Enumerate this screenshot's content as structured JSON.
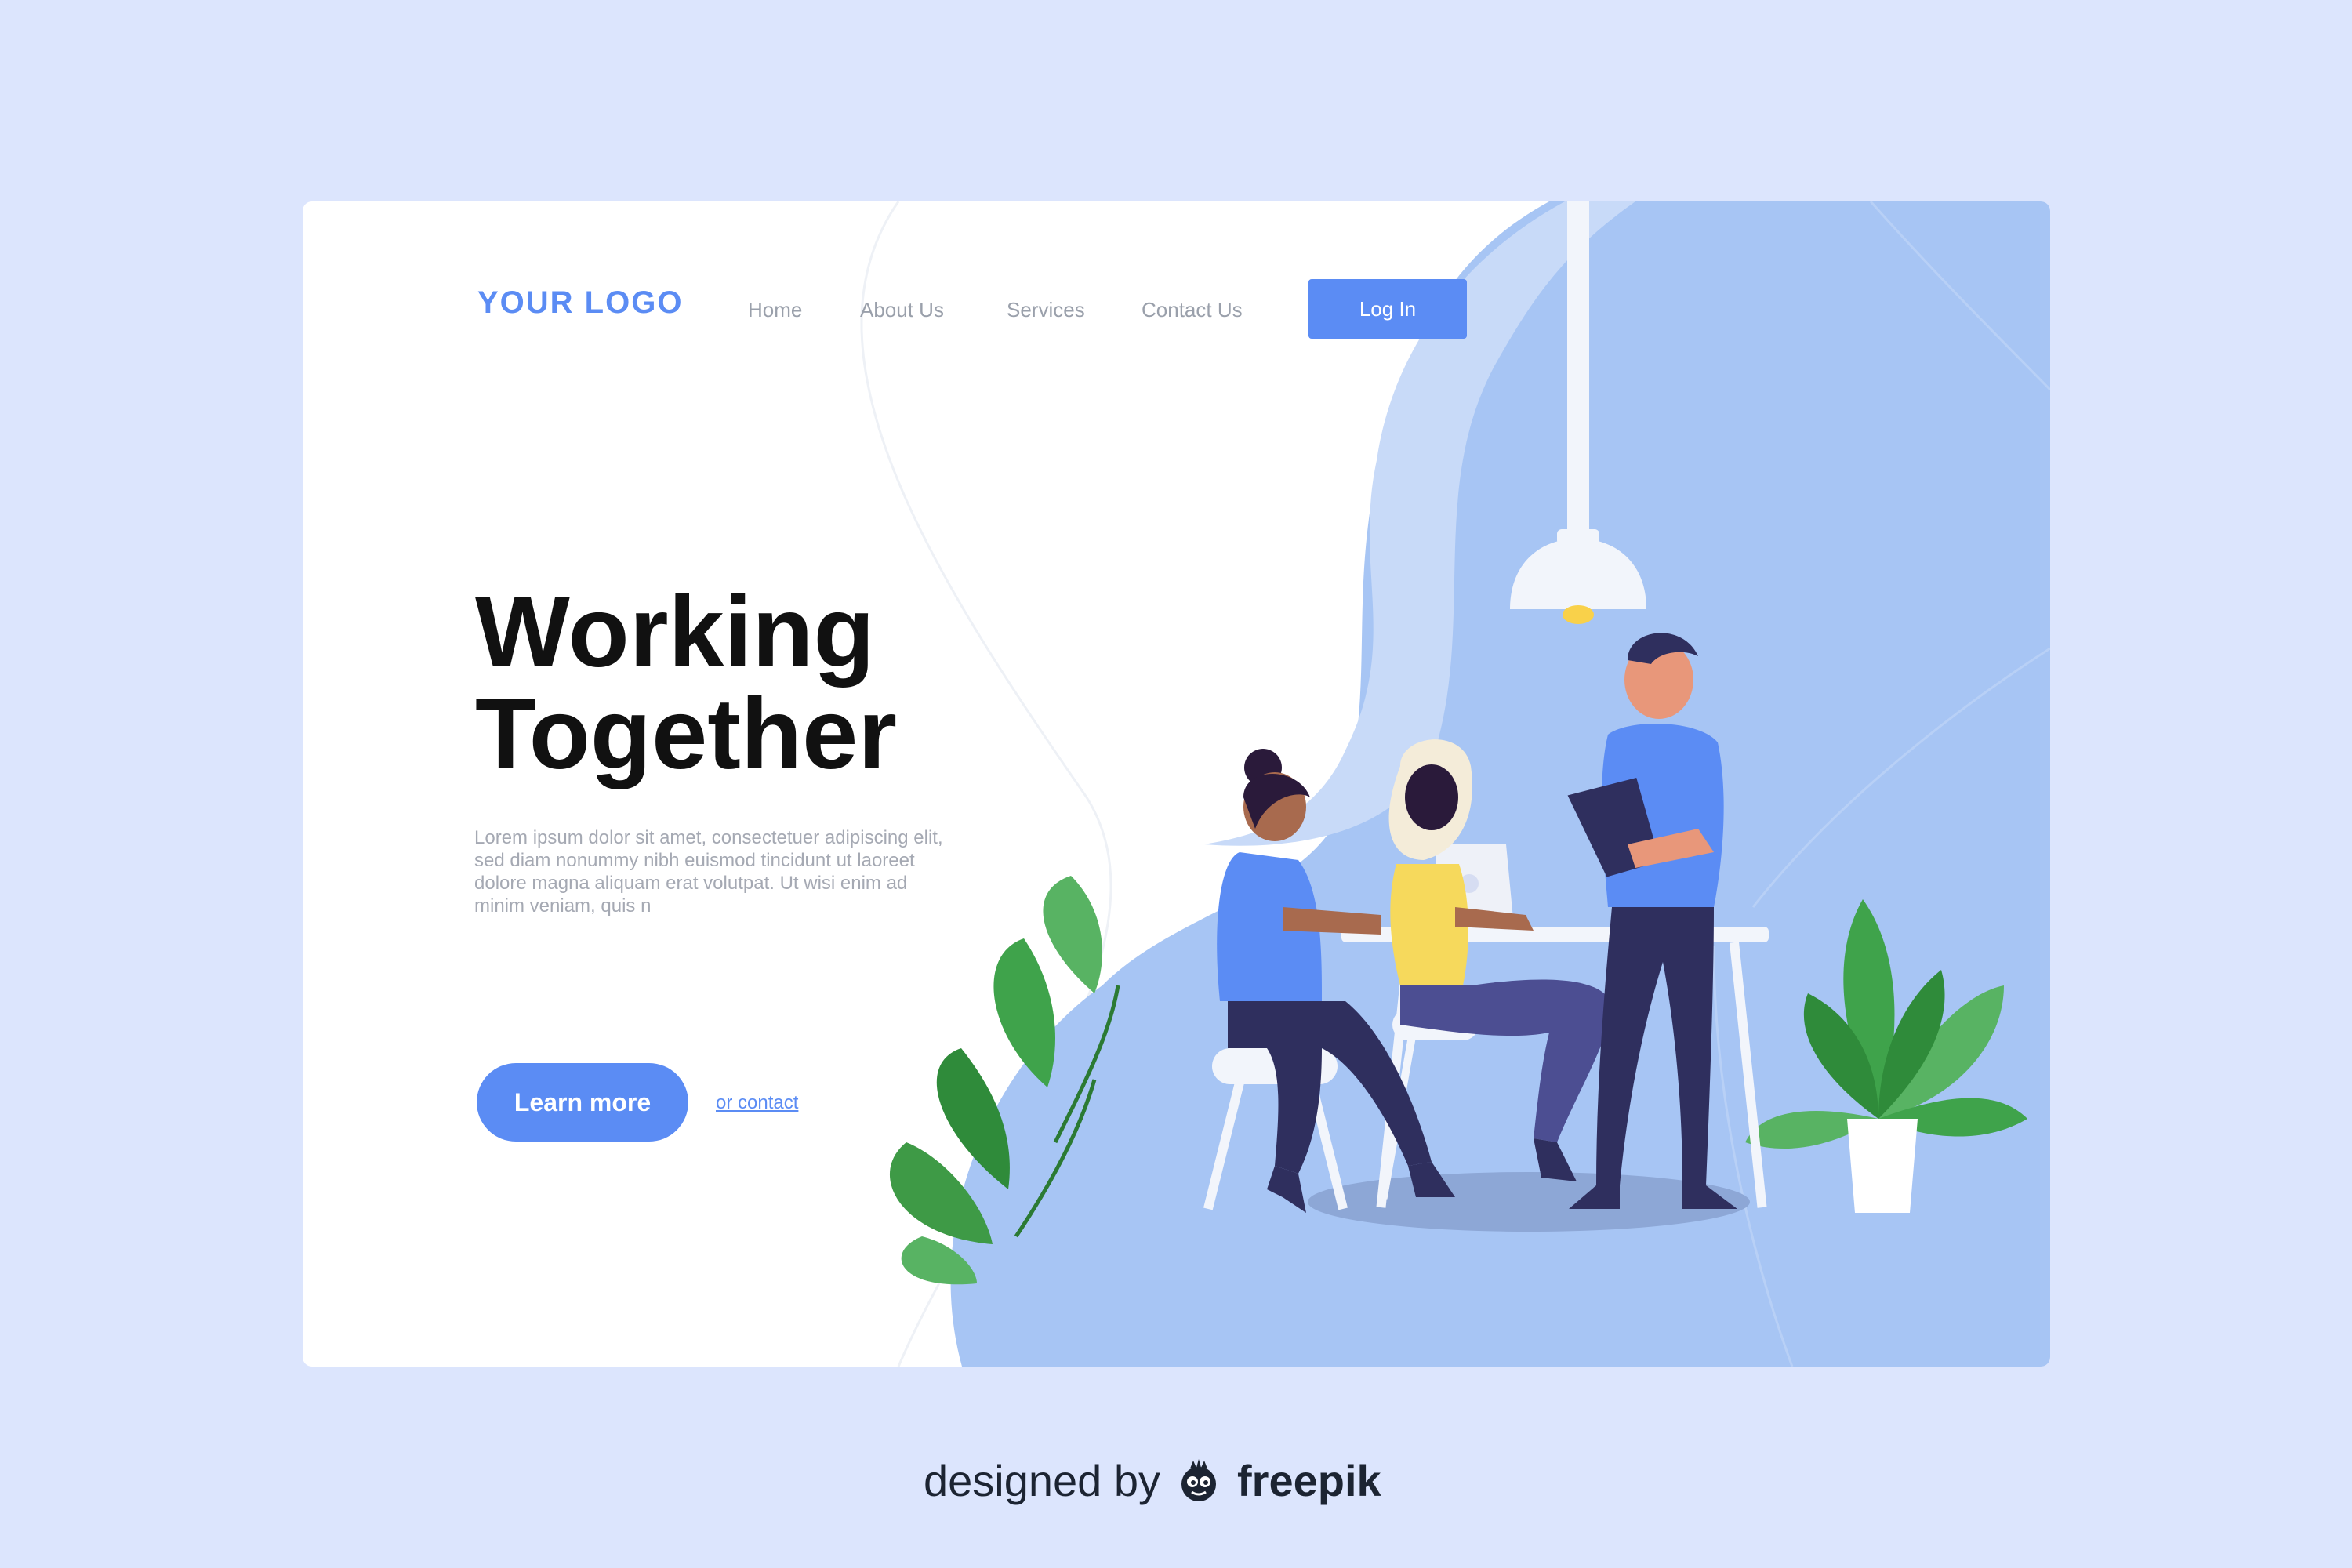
{
  "header": {
    "logo": "YOUR LOGO",
    "nav": [
      {
        "label": "Home"
      },
      {
        "label": "About Us"
      },
      {
        "label": "Services"
      },
      {
        "label": "Contact Us"
      }
    ],
    "login_label": "Log In"
  },
  "hero": {
    "title_line1": "Working",
    "title_line2": "Together",
    "body": "Lorem ipsum dolor sit amet, consectetuer adipiscing elit, sed diam nonummy nibh euismod tincidunt ut laoreet dolore magna aliquam erat volutpat. Ut wisi enim ad minim veniam, quis n",
    "cta_label": "Learn more",
    "secondary_link": "or contact"
  },
  "credit": {
    "prefix": "designed by",
    "brand": "freepik"
  },
  "colors": {
    "page_background": "#dce5fd",
    "card_background": "#ffffff",
    "accent": "#5b8cf4",
    "illustration_blue": "#a7c5f4",
    "title_text": "#111111",
    "body_text": "#a5a9b3"
  }
}
